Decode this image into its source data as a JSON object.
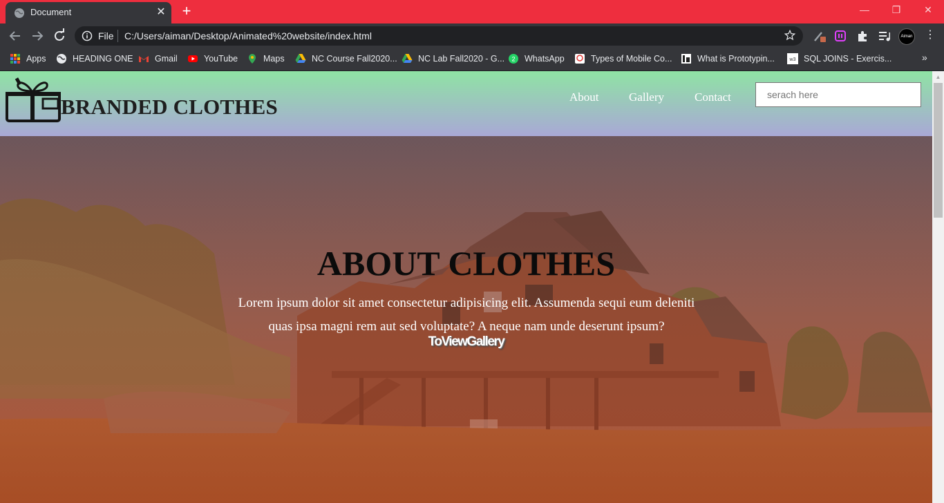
{
  "browser": {
    "tab_title": "Document",
    "tab_close": "✕",
    "new_tab": "+",
    "window_controls": {
      "minimize": "—",
      "maximize": "❐",
      "close": "✕"
    },
    "address_scheme_label": "File",
    "url": "C:/Users/aiman/Desktop/Animated%20website/index.html",
    "profile_label": "Aiman",
    "bookmarks": [
      {
        "label": "Apps",
        "icon": "apps-grid-icon"
      },
      {
        "label": "HEADING ONE",
        "icon": "globe-icon"
      },
      {
        "label": "Gmail",
        "icon": "gmail-icon"
      },
      {
        "label": "YouTube",
        "icon": "youtube-icon"
      },
      {
        "label": "Maps",
        "icon": "maps-pin-icon"
      },
      {
        "label": "NC Course Fall2020...",
        "icon": "google-drive-icon"
      },
      {
        "label": "NC Lab Fall2020 - G...",
        "icon": "google-drive-icon"
      },
      {
        "label": "WhatsApp",
        "icon": "whatsapp-icon"
      },
      {
        "label": "Types of Mobile Co...",
        "icon": "bookmark-site-icon"
      },
      {
        "label": "What is Prototypin...",
        "icon": "bookmark-site-icon"
      },
      {
        "label": "SQL JOINS - Exercis...",
        "icon": "w3schools-icon"
      }
    ],
    "bookmarks_more": "»",
    "colors": {
      "titlebar": "#ee2e3e",
      "toolbar": "#35363a",
      "omnibox": "#202124"
    }
  },
  "site": {
    "logo_text": "BRANDED CLOTHES",
    "nav": [
      {
        "label": "About"
      },
      {
        "label": "Gallery"
      },
      {
        "label": "Contact"
      }
    ],
    "search": {
      "placeholder": "serach here",
      "value": ""
    },
    "hero": {
      "title": "ABOUT CLOTHES",
      "text": "Lorem ipsum dolor sit amet consectetur adipisicing elit. Assumenda sequi eum deleniti quas ipsa magni rem aut sed voluptate? A neque nam unde deserunt ipsum?",
      "button": "ToViewGallery"
    },
    "colors": {
      "header_top": "#8fe3a4",
      "header_bottom": "#a9a8d6",
      "hero_overlay": "#c0502a"
    }
  }
}
